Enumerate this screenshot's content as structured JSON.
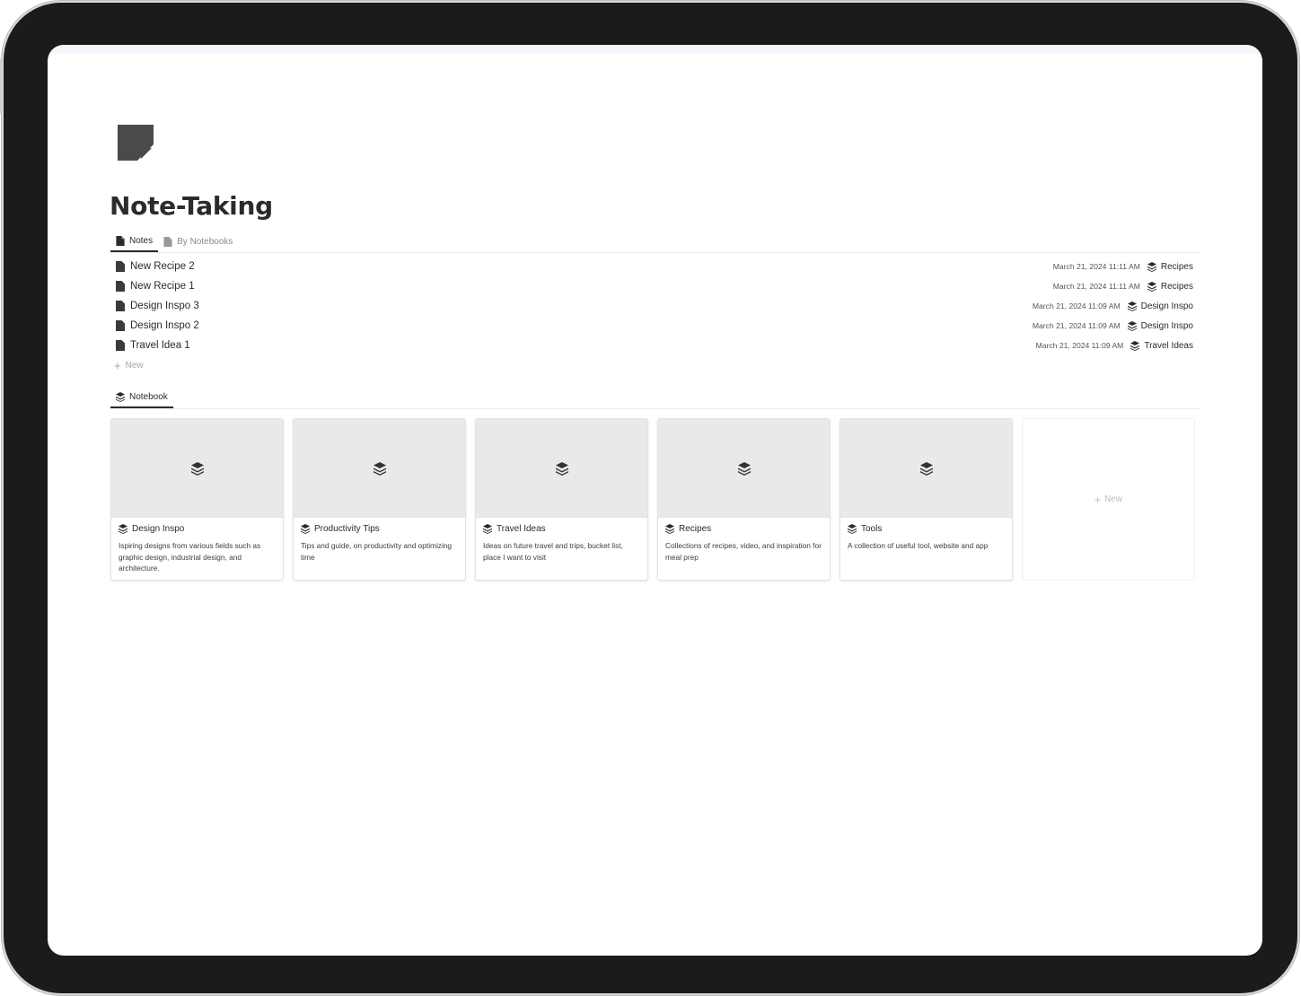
{
  "page": {
    "title": "Note-Taking",
    "icon": "sticky-note-icon"
  },
  "tabs": [
    {
      "label": "Notes",
      "icon": "page-icon",
      "active": true
    },
    {
      "label": "By Notebooks",
      "icon": "page-icon",
      "active": false
    }
  ],
  "notes": [
    {
      "title": "New Recipe 2",
      "date": "March 21, 2024 11:11 AM",
      "notebook": "Recipes"
    },
    {
      "title": "New Recipe 1",
      "date": "March 21, 2024 11:11 AM",
      "notebook": "Recipes"
    },
    {
      "title": "Design Inspo 3",
      "date": "March 21, 2024 11:09 AM",
      "notebook": "Design Inspo"
    },
    {
      "title": "Design Inspo 2",
      "date": "March 21, 2024 11:09 AM",
      "notebook": "Design Inspo"
    },
    {
      "title": "Travel Idea 1",
      "date": "March 21, 2024 11:09 AM",
      "notebook": "Travel Ideas"
    }
  ],
  "notes_new_label": "New",
  "gallery": {
    "tab_label": "Notebook",
    "tab_icon": "stack-icon",
    "new_label": "New",
    "cards": [
      {
        "title": "Design Inspo",
        "description": "Ispiring designs from various fields such as graphic design, industrial design, and architecture."
      },
      {
        "title": "Productivity Tips",
        "description": "Tips and guide, on productivity and optimizing time"
      },
      {
        "title": "Travel Ideas",
        "description": "Ideas on future travel and trips, bucket list, place I want to visit"
      },
      {
        "title": "Recipes",
        "description": "Collections of recipes, video, and inspiration for meal prep"
      },
      {
        "title": "Tools",
        "description": "A collection of useful tool, website and app"
      }
    ]
  },
  "colors": {
    "text": "#2b2b2b",
    "muted": "#8a8a8a",
    "cover": "#e9e9e9",
    "device_frame": "#1b1b1b"
  }
}
